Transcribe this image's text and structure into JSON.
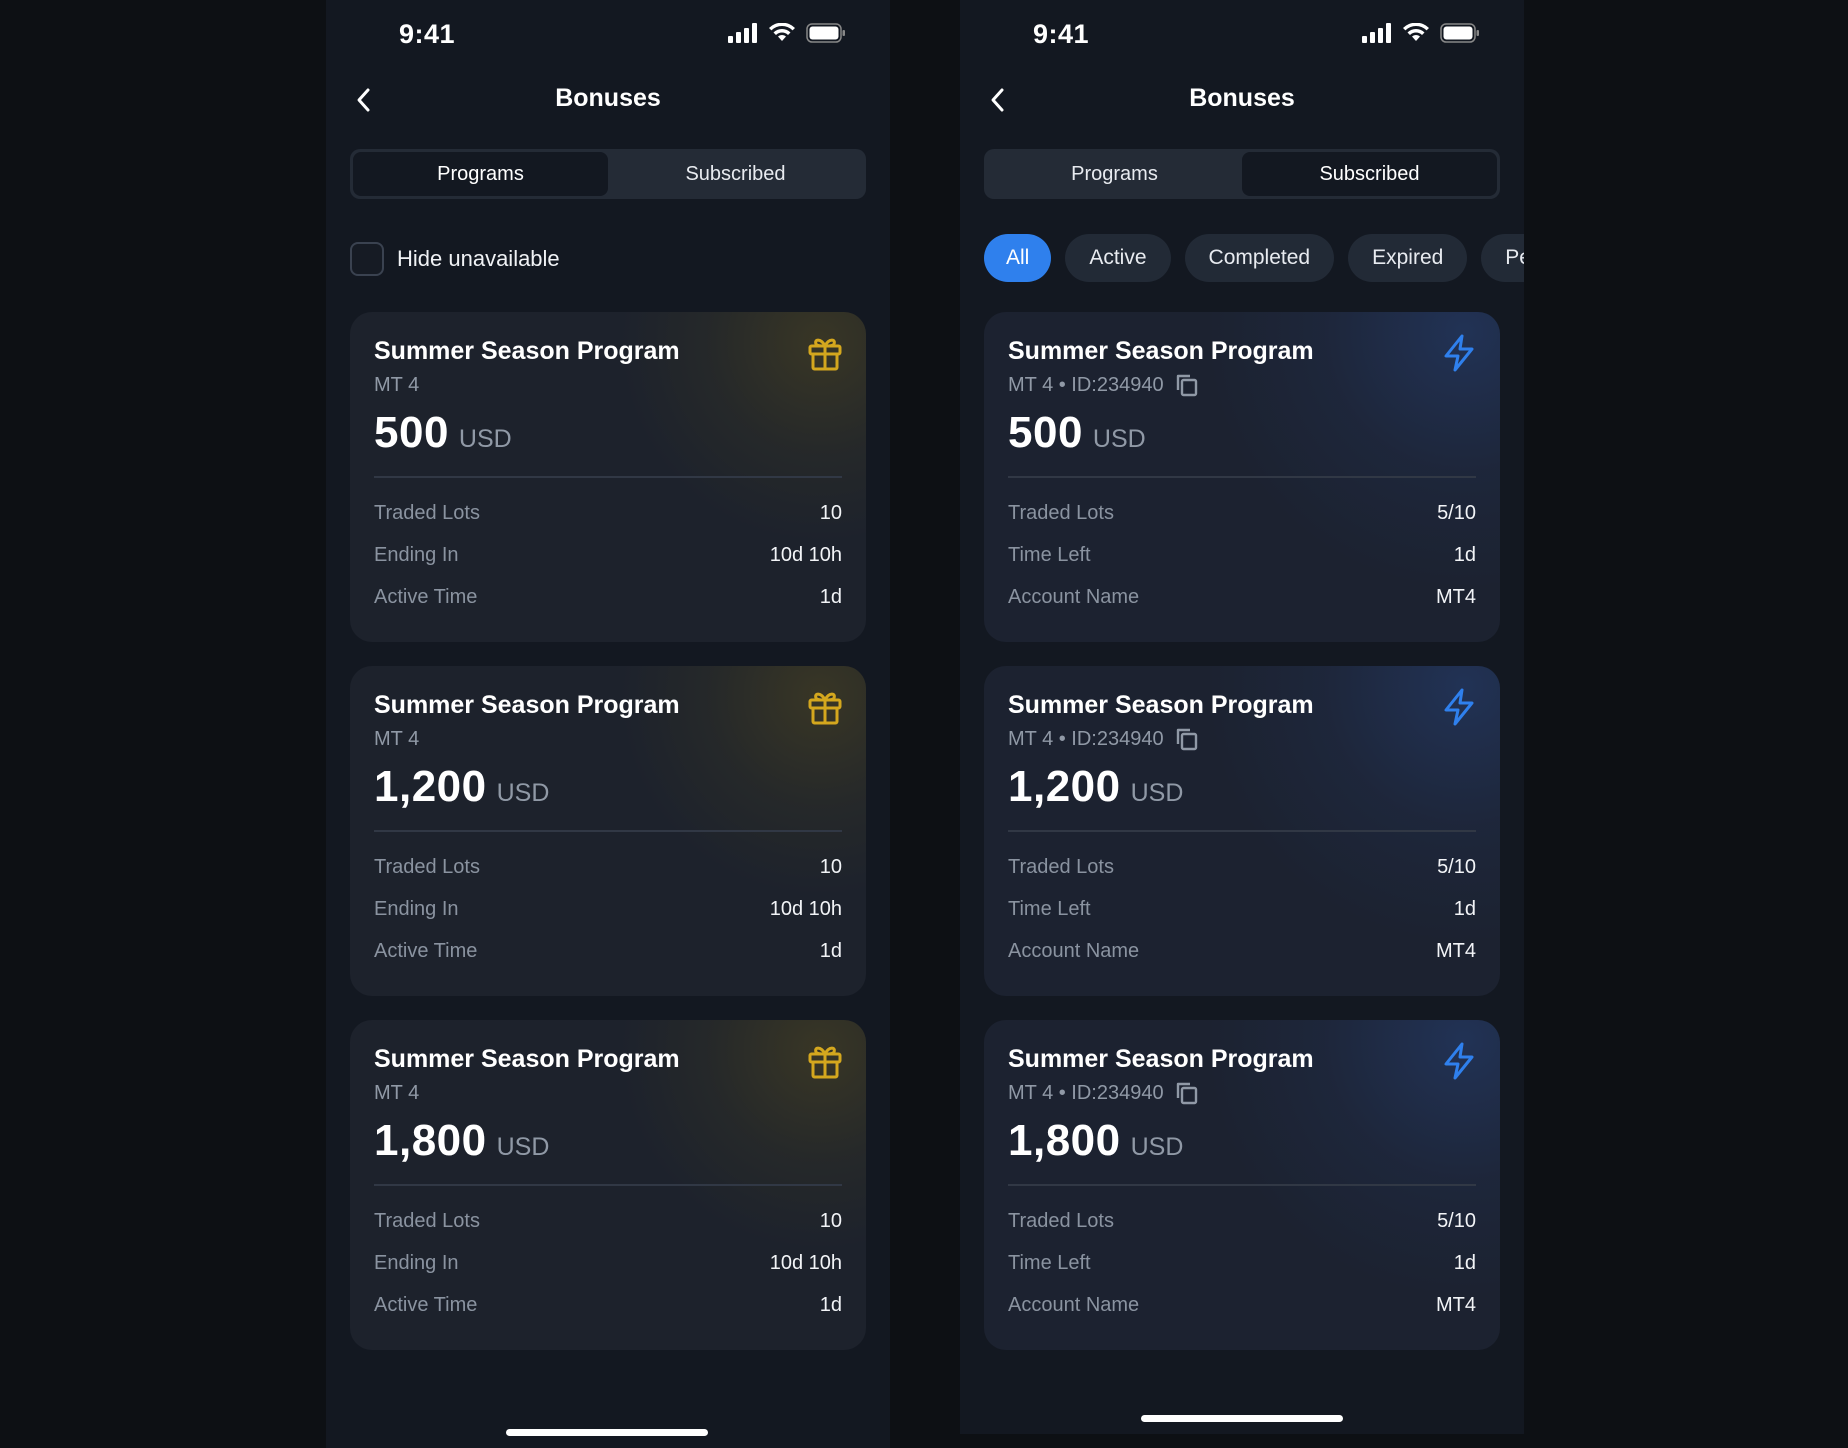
{
  "left_screen": {
    "status_time": "9:41",
    "title": "Bonuses",
    "tabs": [
      {
        "label": "Programs",
        "selected": true
      },
      {
        "label": "Subscribed",
        "selected": false
      }
    ],
    "hide_unavailable_label": "Hide unavailable",
    "hide_unavailable_checked": false,
    "card_icon": "gift-icon",
    "cards": [
      {
        "title": "Summer Season Program",
        "subtitle": "MT 4",
        "amount": "500",
        "currency": "USD",
        "rows": [
          {
            "label": "Traded Lots",
            "value": "10"
          },
          {
            "label": "Ending In",
            "value": "10d 10h"
          },
          {
            "label": "Active Time",
            "value": "1d"
          }
        ]
      },
      {
        "title": "Summer Season Program",
        "subtitle": "MT 4",
        "amount": "1,200",
        "currency": "USD",
        "rows": [
          {
            "label": "Traded Lots",
            "value": "10"
          },
          {
            "label": "Ending In",
            "value": "10d 10h"
          },
          {
            "label": "Active Time",
            "value": "1d"
          }
        ]
      },
      {
        "title": "Summer Season Program",
        "subtitle": "MT 4",
        "amount": "1,800",
        "currency": "USD",
        "rows": [
          {
            "label": "Traded Lots",
            "value": "10"
          },
          {
            "label": "Ending In",
            "value": "10d 10h"
          },
          {
            "label": "Active Time",
            "value": "1d"
          }
        ]
      }
    ]
  },
  "right_screen": {
    "status_time": "9:41",
    "title": "Bonuses",
    "tabs": [
      {
        "label": "Programs",
        "selected": false
      },
      {
        "label": "Subscribed",
        "selected": true
      }
    ],
    "filters": [
      {
        "label": "All",
        "selected": true
      },
      {
        "label": "Active",
        "selected": false
      },
      {
        "label": "Completed",
        "selected": false
      },
      {
        "label": "Expired",
        "selected": false
      },
      {
        "label": "Pe",
        "selected": false
      }
    ],
    "card_icon": "lightning-icon",
    "cards": [
      {
        "title": "Summer Season Program",
        "subtitle": "MT 4 • ID:234940",
        "amount": "500",
        "currency": "USD",
        "rows": [
          {
            "label": "Traded Lots",
            "value": "5/10"
          },
          {
            "label": "Time Left",
            "value": "1d"
          },
          {
            "label": "Account Name",
            "value": "MT4"
          }
        ]
      },
      {
        "title": "Summer Season Program",
        "subtitle": "MT 4 • ID:234940",
        "amount": "1,200",
        "currency": "USD",
        "rows": [
          {
            "label": "Traded Lots",
            "value": "5/10"
          },
          {
            "label": "Time Left",
            "value": "1d"
          },
          {
            "label": "Account Name",
            "value": "MT4"
          }
        ]
      },
      {
        "title": "Summer Season Program",
        "subtitle": "MT 4 • ID:234940",
        "amount": "1,800",
        "currency": "USD",
        "rows": [
          {
            "label": "Traded Lots",
            "value": "5/10"
          },
          {
            "label": "Time Left",
            "value": "1d"
          },
          {
            "label": "Account Name",
            "value": "MT4"
          }
        ]
      }
    ]
  },
  "colors": {
    "page_background": "#0d1014",
    "screen_background": "#131821",
    "card_background": "#1d222c",
    "accent_blue": "#2f80ed",
    "gift_yellow": "#d4a71e",
    "muted_text": "#8a93a0"
  }
}
